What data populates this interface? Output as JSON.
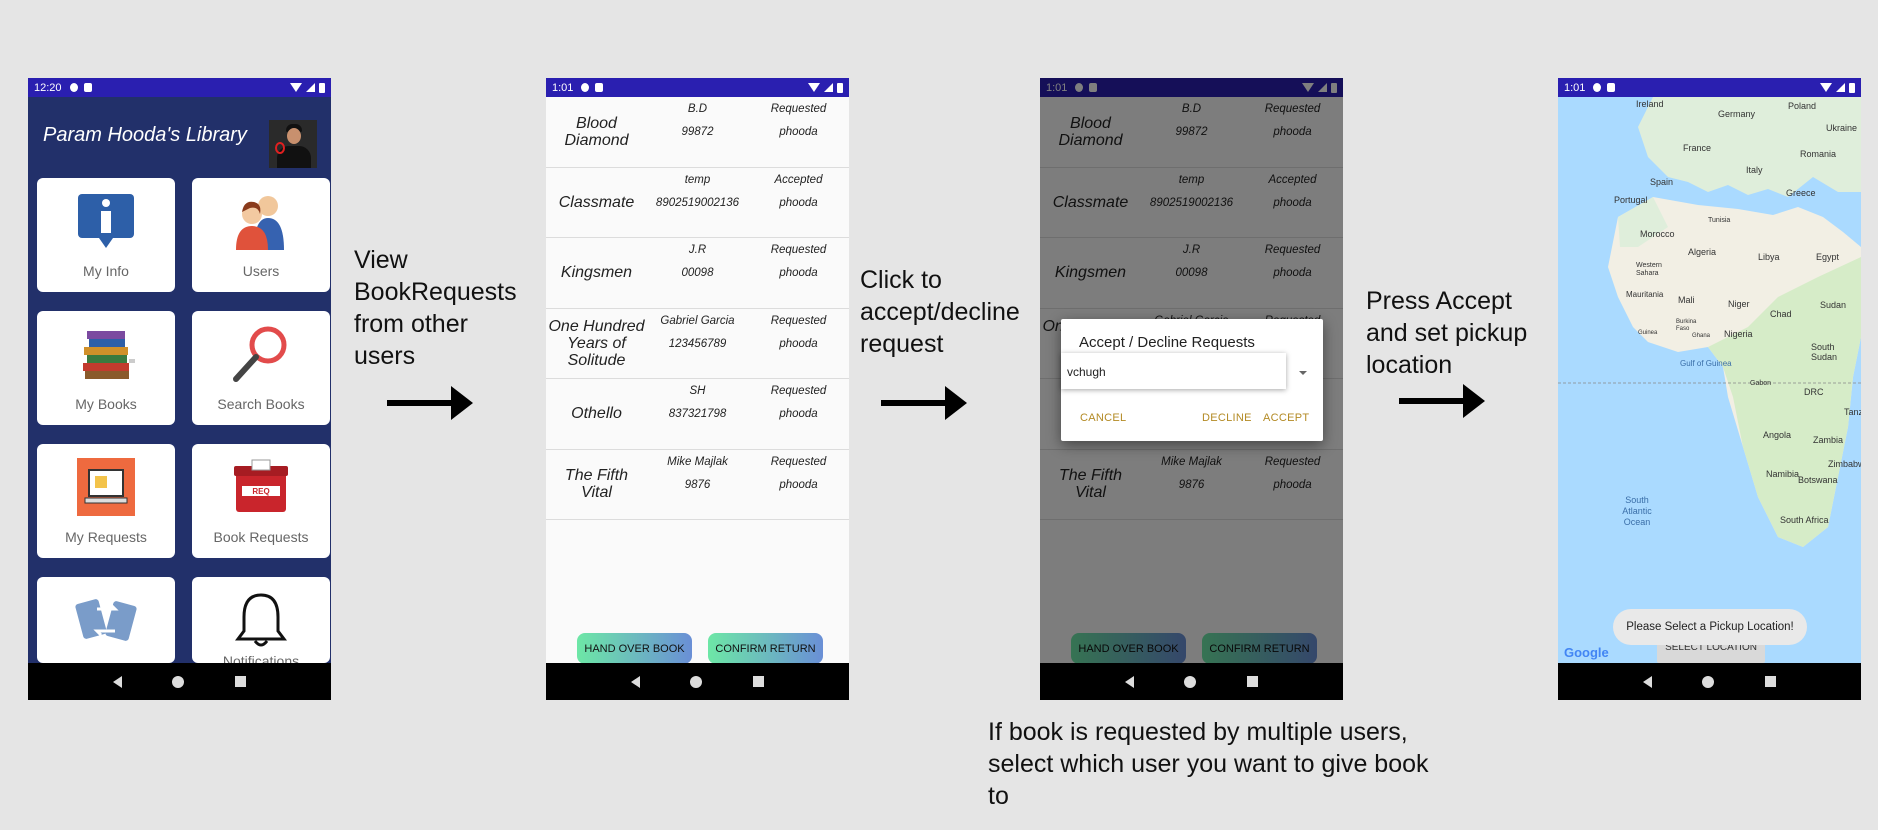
{
  "phone1": {
    "status_time": "12:20",
    "library_title": "Param Hooda's Library",
    "tiles": [
      {
        "label": "My Info",
        "icon": "info-icon"
      },
      {
        "label": "Users",
        "icon": "users-icon"
      },
      {
        "label": "My Books",
        "icon": "books-icon"
      },
      {
        "label": "Search Books",
        "icon": "magnifier-icon"
      },
      {
        "label": "My Requests",
        "icon": "monitor-icon"
      },
      {
        "label": "Book Requests",
        "icon": "requests-box-icon"
      },
      {
        "label": "",
        "icon": "exchange-icon"
      },
      {
        "label": "Notifications",
        "icon": "bell-icon"
      }
    ]
  },
  "requests": [
    {
      "title": "Blood Diamond",
      "author": "B.D",
      "isbn": "99872",
      "status": "Requested",
      "owner": "phooda"
    },
    {
      "title": "Classmate",
      "author": "temp",
      "isbn": "8902519002136",
      "status": "Accepted",
      "owner": "phooda"
    },
    {
      "title": "Kingsmen",
      "author": "J.R",
      "isbn": "00098",
      "status": "Requested",
      "owner": "phooda"
    },
    {
      "title": "One Hundred Years of Solitude",
      "author": "Gabriel Garcia",
      "isbn": "123456789",
      "status": "Requested",
      "owner": "phooda"
    },
    {
      "title": "Othello",
      "author": "SH",
      "isbn": "837321798",
      "status": "Requested",
      "owner": "phooda"
    },
    {
      "title": "The Fifth Vital",
      "author": "Mike Majlak",
      "isbn": "9876",
      "status": "Requested",
      "owner": "phooda"
    }
  ],
  "phone2": {
    "status_time": "1:01",
    "hand_over_label": "HAND OVER BOOK",
    "confirm_return_label": "CONFIRM RETURN"
  },
  "phone3": {
    "status_time": "1:01",
    "dialog": {
      "title": "Accept / Decline Requests",
      "selected_user": "vchugh",
      "cancel_label": "CANCEL",
      "decline_label": "DECLINE",
      "accept_label": "ACCEPT"
    }
  },
  "phone4": {
    "status_time": "1:01",
    "toast": "Please Select a Pickup Location!",
    "select_location_label": "SELECT LOCATION",
    "google_logo": "Google",
    "map_labels": {
      "ireland": "Ireland",
      "germany": "Germany",
      "poland": "Poland",
      "ukraine": "Ukraine",
      "france": "France",
      "romania": "Romania",
      "italy": "Italy",
      "spain": "Spain",
      "portugal": "Portugal",
      "greece": "Greece",
      "tunisia": "Tunisia",
      "morocco": "Morocco",
      "algeria": "Algeria",
      "libya": "Libya",
      "egypt": "Egypt",
      "western_sahara": "Western Sahara",
      "mauritania": "Mauritania",
      "mali": "Mali",
      "niger": "Niger",
      "chad": "Chad",
      "sudan": "Sudan",
      "burkina_faso": "Burkina Faso",
      "nigeria": "Nigeria",
      "guinea": "Guinea",
      "ghana": "Ghana",
      "south_sudan": "South Sudan",
      "gulf_of_guinea": "Gulf of Guinea",
      "gabon": "Gabon",
      "drc": "DRC",
      "tanzania": "Tanzania",
      "angola": "Angola",
      "zambia": "Zambia",
      "namibia": "Namibia",
      "zimbabwe": "Zimbabwe",
      "botswana": "Botswana",
      "south_africa": "South Africa",
      "south_atlantic_ocean": "South Atlantic Ocean"
    }
  },
  "captions": {
    "view_requests": "View BookRequests from other users",
    "click_accept": "Click to accept/decline request",
    "press_accept": "Press Accept and set pickup location",
    "multiple_users": "If book is requested by multiple users, select which user you want to give book to"
  },
  "colors": {
    "status_bar": "#2a1fb0",
    "library_bg": "#22306a",
    "dialog_button": "#b38a24",
    "background": "#e5e5e5"
  }
}
